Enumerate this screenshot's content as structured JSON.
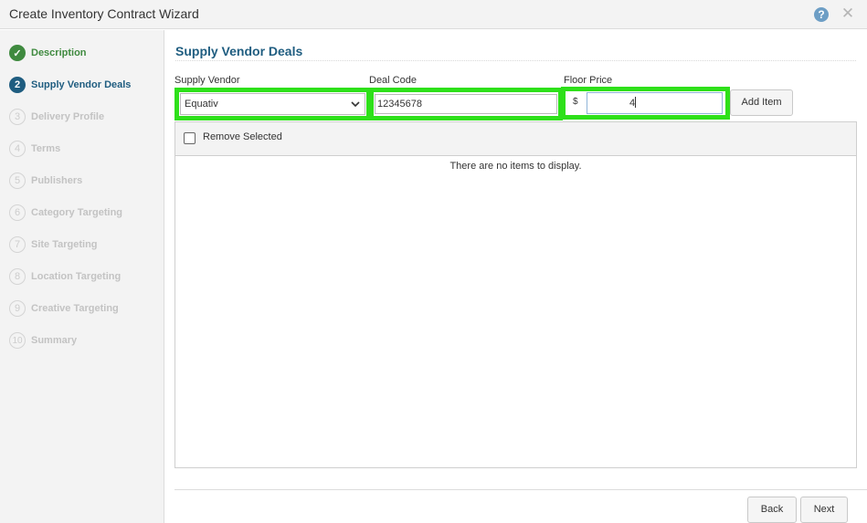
{
  "window": {
    "title": "Create Inventory Contract Wizard",
    "help_glyph": "?",
    "close_glyph": "✕"
  },
  "sidebar": {
    "steps": [
      {
        "badge": "✓",
        "label": "Description",
        "state": "done"
      },
      {
        "badge": "2",
        "label": "Supply Vendor Deals",
        "state": "current"
      },
      {
        "badge": "3",
        "label": "Delivery Profile",
        "state": "pending"
      },
      {
        "badge": "4",
        "label": "Terms",
        "state": "pending"
      },
      {
        "badge": "5",
        "label": "Publishers",
        "state": "pending"
      },
      {
        "badge": "6",
        "label": "Category Targeting",
        "state": "pending"
      },
      {
        "badge": "7",
        "label": "Site Targeting",
        "state": "pending"
      },
      {
        "badge": "8",
        "label": "Location Targeting",
        "state": "pending"
      },
      {
        "badge": "9",
        "label": "Creative Targeting",
        "state": "pending"
      },
      {
        "badge": "10",
        "label": "Summary",
        "state": "pending"
      }
    ]
  },
  "main": {
    "section_title": "Supply Vendor Deals",
    "supply_vendor": {
      "label": "Supply Vendor",
      "value": "Equativ"
    },
    "deal_code": {
      "label": "Deal Code",
      "value": "12345678"
    },
    "floor_price": {
      "label": "Floor Price",
      "currency": "$",
      "value": "4"
    },
    "add_item_label": "Add Item",
    "grid": {
      "remove_selected_label": "Remove Selected",
      "empty_message": "There are no items to display."
    }
  },
  "footer": {
    "back_label": "Back",
    "next_label": "Next"
  },
  "colors": {
    "highlight": "#2ee01a",
    "done": "#3f8a3f",
    "current": "#1f5d80",
    "pending": "#c3c3c3"
  }
}
